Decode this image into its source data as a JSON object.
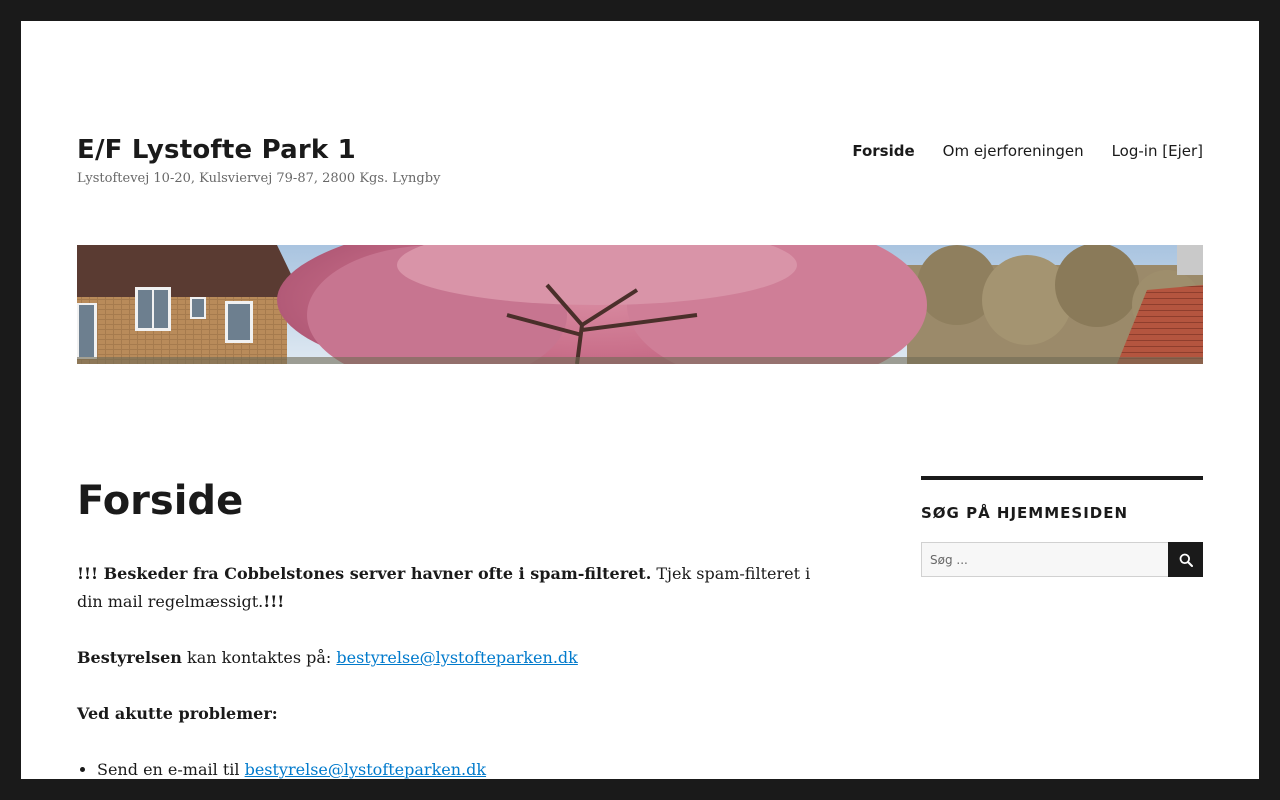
{
  "site": {
    "title": "E/F Lystofte Park 1",
    "description": "Lystoftevej 10-20, Kulsviervej 79-87, 2800 Kgs. Lyngby"
  },
  "nav": {
    "items": [
      {
        "label": "Forside",
        "current": true
      },
      {
        "label": "Om ejerforeningen",
        "current": false
      },
      {
        "label": "Log-in [Ejer]",
        "current": false
      }
    ]
  },
  "page": {
    "title": "Forside",
    "p1_bold": "!!! Beskeder fra Cobbelstones server havner ofte i spam-filteret.",
    "p1_text": " Tjek spam-filteret i din mail regelmæssigt.",
    "p1_end": "!!!",
    "p2_bold": "Bestyrelsen",
    "p2_text": " kan kontaktes på: ",
    "p2_link": "bestyrelse@lystofteparken.dk",
    "p3_bold": "Ved akutte problemer:",
    "list_item_text": "Send en e-mail til ",
    "list_item_link": "bestyrelse@lystofteparken.dk"
  },
  "sidebar": {
    "search_title": "SØG PÅ HJEMMESIDEN",
    "search_placeholder": "Søg ...",
    "search_button_icon": "search-icon"
  },
  "colors": {
    "link": "#007acc",
    "text": "#1a1a1a",
    "frame": "#1a1a1a"
  }
}
